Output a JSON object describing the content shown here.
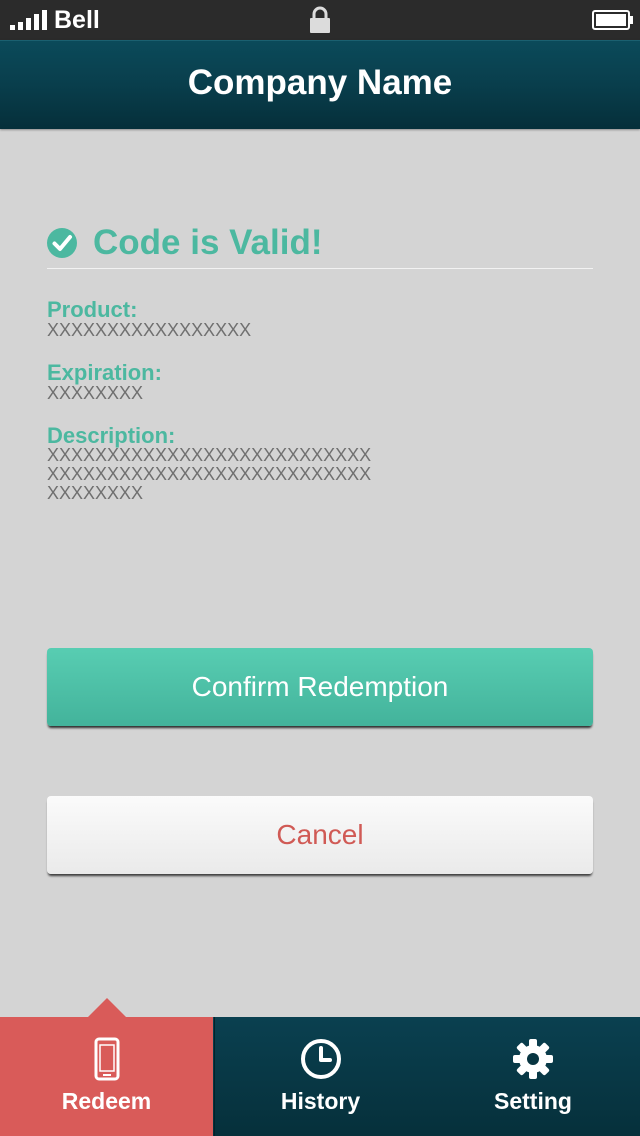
{
  "status_bar": {
    "carrier": "Bell",
    "signal_icon": "signal-bars-icon",
    "lock_icon": "lock-icon",
    "battery_icon": "battery-icon"
  },
  "nav": {
    "title": "Company Name"
  },
  "result": {
    "icon": "checkmark-circle-icon",
    "title": "Code is Valid!"
  },
  "fields": {
    "product_label": "Product:",
    "product_value": "XXXXXXXXXXXXXXXXX",
    "expiration_label": "Expiration:",
    "expiration_value": "XXXXXXXX",
    "description_label": "Description:",
    "description_value": "XXXXXXXXXXXXXXXXXXXXXXXXXXX\nXXXXXXXXXXXXXXXXXXXXXXXXXXX\nXXXXXXXX"
  },
  "buttons": {
    "confirm_label": "Confirm Redemption",
    "cancel_label": "Cancel"
  },
  "tabs": [
    {
      "label": "Redeem",
      "icon": "phone-icon",
      "active": true
    },
    {
      "label": "History",
      "icon": "clock-icon",
      "active": false
    },
    {
      "label": "Setting",
      "icon": "gear-icon",
      "active": false
    }
  ],
  "colors": {
    "accent": "#4cb8a0",
    "nav_bar": "#093e4c",
    "active_tab": "#d95b59",
    "cancel_text": "#d05a55",
    "background": "#d4d4d4"
  }
}
